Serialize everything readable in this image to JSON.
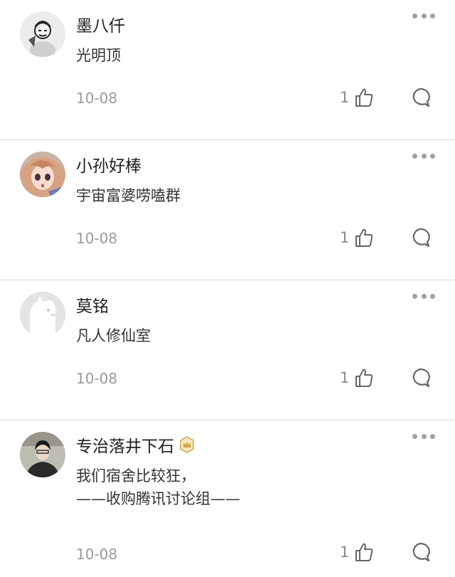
{
  "comments": [
    {
      "name": "墨八仟",
      "text_lines": [
        "光明顶"
      ],
      "date": "10-08",
      "likes": "1",
      "avatar": "ink-warrior-avatar"
    },
    {
      "name": "小孙好棒",
      "text_lines": [
        "宇宙富婆唠嗑群"
      ],
      "date": "10-08",
      "likes": "1",
      "avatar": "anime-girl-avatar"
    },
    {
      "name": "莫铭",
      "text_lines": [
        "凡人修仙室"
      ],
      "date": "10-08",
      "likes": "1",
      "avatar": "default-dog-avatar"
    },
    {
      "name": "专治落井下石",
      "text_lines": [
        "我们宿舍比较狂，",
        "——收购腾讯讨论组——"
      ],
      "date": "10-08",
      "likes": "1",
      "avatar": "portrait-photo-avatar",
      "badge": "crown-badge-icon"
    }
  ],
  "icons": {
    "more": "more-dots-icon",
    "like": "thumbs-up-icon",
    "reply": "comment-bubble-icon"
  },
  "colors": {
    "badge": "#d4a640",
    "muted": "#9a9a9a",
    "divider": "#d9d9d9"
  }
}
